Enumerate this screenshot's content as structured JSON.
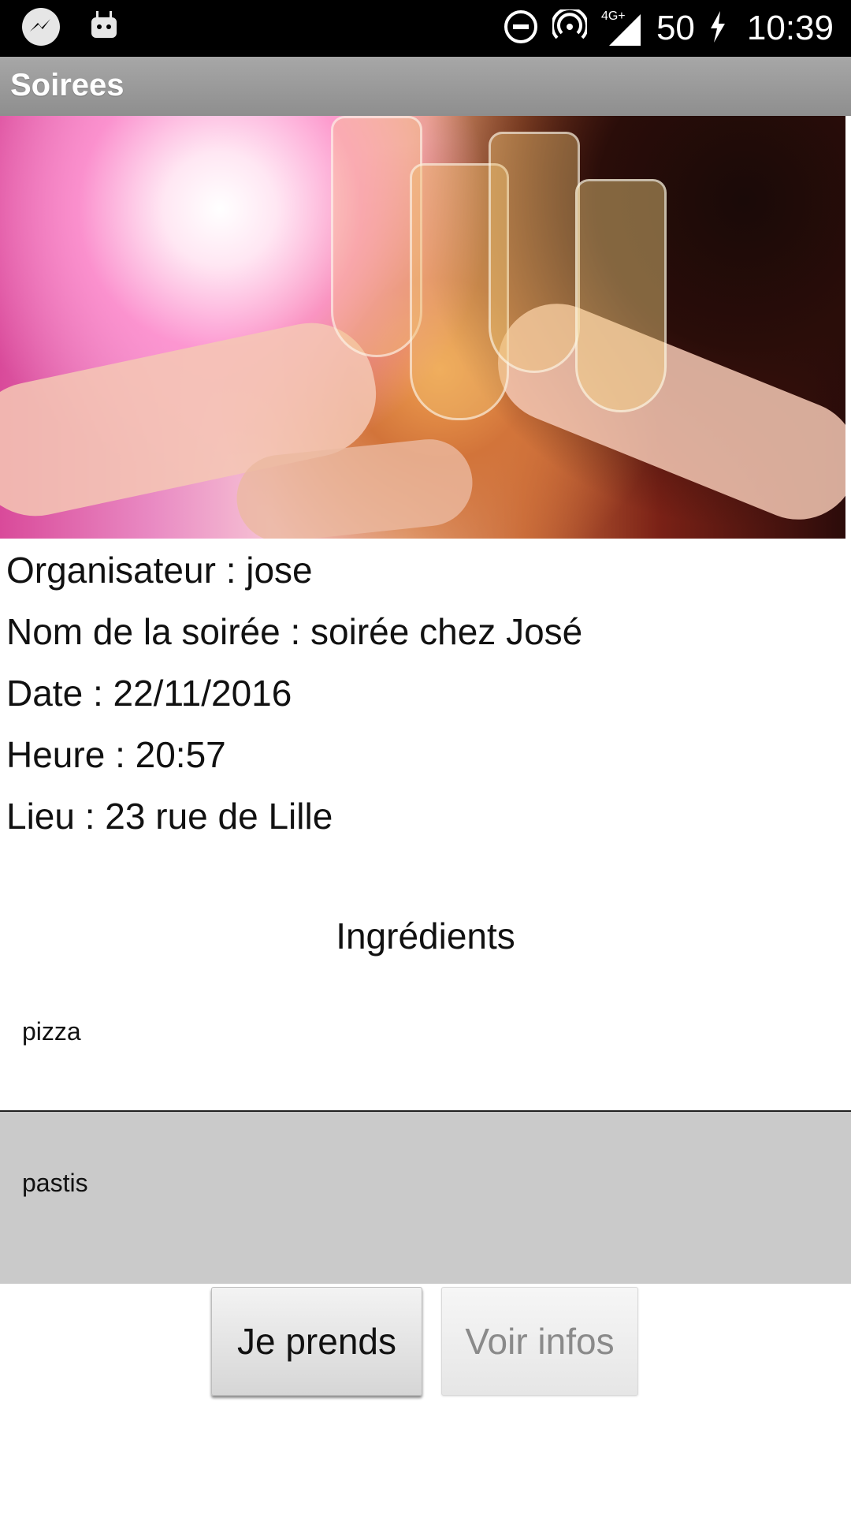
{
  "status_bar": {
    "battery_level": "50",
    "network": "4G+",
    "time": "10:39"
  },
  "app_bar": {
    "title": "Soirees"
  },
  "details": {
    "organizer": "Organisateur : jose",
    "party_name": "Nom de la soirée : soirée chez José",
    "date": "Date : 22/11/2016",
    "time": "Heure : 20:57",
    "location": "Lieu : 23 rue de Lille"
  },
  "ingredients": {
    "title": "Ingrédients",
    "items": [
      {
        "label": "pizza"
      },
      {
        "label": "pastis"
      }
    ]
  },
  "buttons": {
    "take_label": "Je prends",
    "info_label": "Voir infos"
  }
}
